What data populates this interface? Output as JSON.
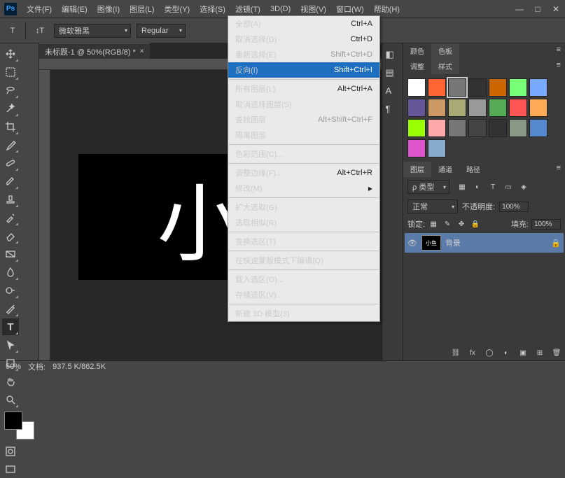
{
  "app": {
    "logo": "Ps"
  },
  "menubar": [
    "文件(F)",
    "编辑(E)",
    "图像(I)",
    "图层(L)",
    "类型(Y)",
    "选择(S)",
    "滤镜(T)",
    "3D(D)",
    "视图(V)",
    "窗口(W)",
    "帮助(H)"
  ],
  "optbar": {
    "tool": "T",
    "font": "微软雅黑",
    "weight": "Regular"
  },
  "doc": {
    "tab": "未标题-1 @ 50%(RGB/8) *",
    "canvas_text": "小",
    "zoom": "50%",
    "filesize": "937.5 K/862.5K",
    "filesize_label": "文档:"
  },
  "select_menu": {
    "items": [
      {
        "t": "全部(A)",
        "sc": "Ctrl+A"
      },
      {
        "t": "取消选择(D)",
        "sc": "Ctrl+D"
      },
      {
        "t": "重新选择(E)",
        "sc": "Shift+Ctrl+D",
        "disabled": true
      },
      {
        "t": "反向(I)",
        "sc": "Shift+Ctrl+I",
        "hl": true
      },
      {
        "sep": true
      },
      {
        "t": "所有图层(L)",
        "sc": "Alt+Ctrl+A"
      },
      {
        "t": "取消选择图层(S)",
        "disabled": true
      },
      {
        "t": "查找图层",
        "sc": "Alt+Shift+Ctrl+F",
        "disabled": true
      },
      {
        "t": "隔离图层",
        "disabled": true
      },
      {
        "sep": true
      },
      {
        "t": "色彩范围(C)..."
      },
      {
        "sep": true
      },
      {
        "t": "调整边缘(F)...",
        "sc": "Alt+Ctrl+R"
      },
      {
        "t": "修改(M)",
        "sub": true
      },
      {
        "sep": true
      },
      {
        "t": "扩大选取(G)"
      },
      {
        "t": "选取相似(R)"
      },
      {
        "sep": true
      },
      {
        "t": "变换选区(T)"
      },
      {
        "sep": true
      },
      {
        "t": "在快速蒙版模式下编辑(Q)"
      },
      {
        "sep": true
      },
      {
        "t": "载入选区(O)...",
        "disabled": true
      },
      {
        "t": "存储选区(V)..."
      },
      {
        "sep": true
      },
      {
        "t": "新建 3D 模型(3)"
      }
    ]
  },
  "panels": {
    "color_tab": "颜色",
    "swatch_tab": "色板",
    "adjust_tab": "调整",
    "styles_tab": "样式",
    "layers_tab": "图层",
    "channels_tab": "通道",
    "paths_tab": "路径",
    "kind_label": "ρ 类型",
    "blend_mode": "正常",
    "opacity_label": "不透明度:",
    "opacity": "100%",
    "lock_label": "锁定:",
    "fill_label": "填充:",
    "fill": "100%",
    "layer_name": "小鱼",
    "layer_bg": "背景"
  },
  "style_colors": [
    "#fff",
    "#f63",
    "#777",
    "#333",
    "#c60",
    "#7f7",
    "#7af",
    "#659",
    "#c96",
    "#aa7",
    "#999",
    "#5a5",
    "#f55",
    "#fa5",
    "#9f0",
    "#faa",
    "#777",
    "#444",
    "#333",
    "#898",
    "#58c",
    "#d5c",
    "#8ac"
  ]
}
